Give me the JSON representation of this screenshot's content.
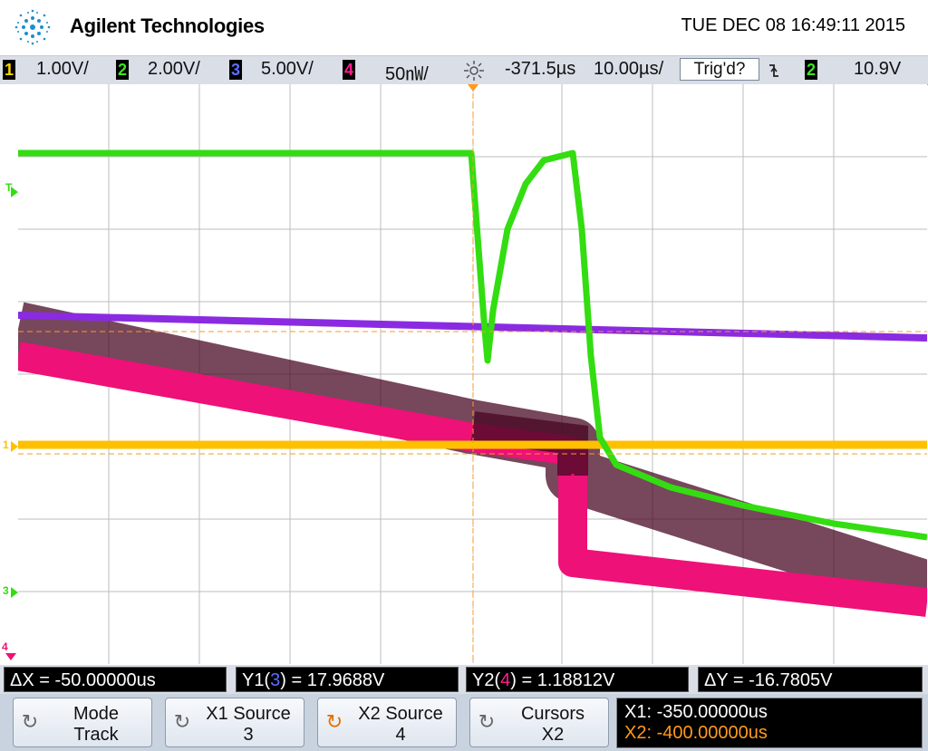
{
  "header": {
    "brand": "Agilent Technologies",
    "datetime": "TUE DEC 08 16:49:11 2015"
  },
  "status": {
    "ch1": {
      "num": "1",
      "scale": "1.00V/",
      "color": "#ffd200"
    },
    "ch2": {
      "num": "2",
      "scale": "2.00V/",
      "color": "#3ce61e"
    },
    "ch3": {
      "num": "3",
      "scale": "5.00V/",
      "color": "#5060ff"
    },
    "ch4": {
      "num": "4",
      "scale": "50㎻/",
      "color": "#ff1e8c"
    },
    "delay": "-371.5µs",
    "timebase": "10.00µs/",
    "trigger_state": "Trig'd?",
    "trigger_source": "2",
    "trigger_level": "10.9V"
  },
  "markers": {
    "trigger_level": "T",
    "ch1": "1",
    "ch3": "3",
    "ch4": "4"
  },
  "measurements": {
    "delta_x": "ΔX = -50.00000us",
    "y1_prefix": "Y1(",
    "y1_src": "3",
    "y1_suffix": ") = 17.9688V",
    "y2_prefix": "Y2(",
    "y2_src": "4",
    "y2_suffix": ") = 1.18812V",
    "delta_y": "ΔY = -16.7805V"
  },
  "softkeys": [
    {
      "line1": "Mode",
      "line2": "Track",
      "icon": "rotary-knob-icon"
    },
    {
      "line1": "X1 Source",
      "line2": "3",
      "icon": "rotary-knob-icon"
    },
    {
      "line1": "X2 Source",
      "line2": "4",
      "icon": "rotary-knob-icon"
    },
    {
      "line1": "Cursors",
      "line2": "X2",
      "icon": "rotary-knob-icon"
    }
  ],
  "cursors": {
    "x1": "X1: -350.00000us",
    "x2": "X2: -400.00000us"
  },
  "colors": {
    "ch1": "#ffc000",
    "ch2": "#33dd11",
    "ch3": "#8a2be2",
    "ch4": "#ee1177",
    "ch4_noise": "#4a0a26",
    "cursor": "#ff9a1e",
    "grid": "#b9b9b9"
  }
}
